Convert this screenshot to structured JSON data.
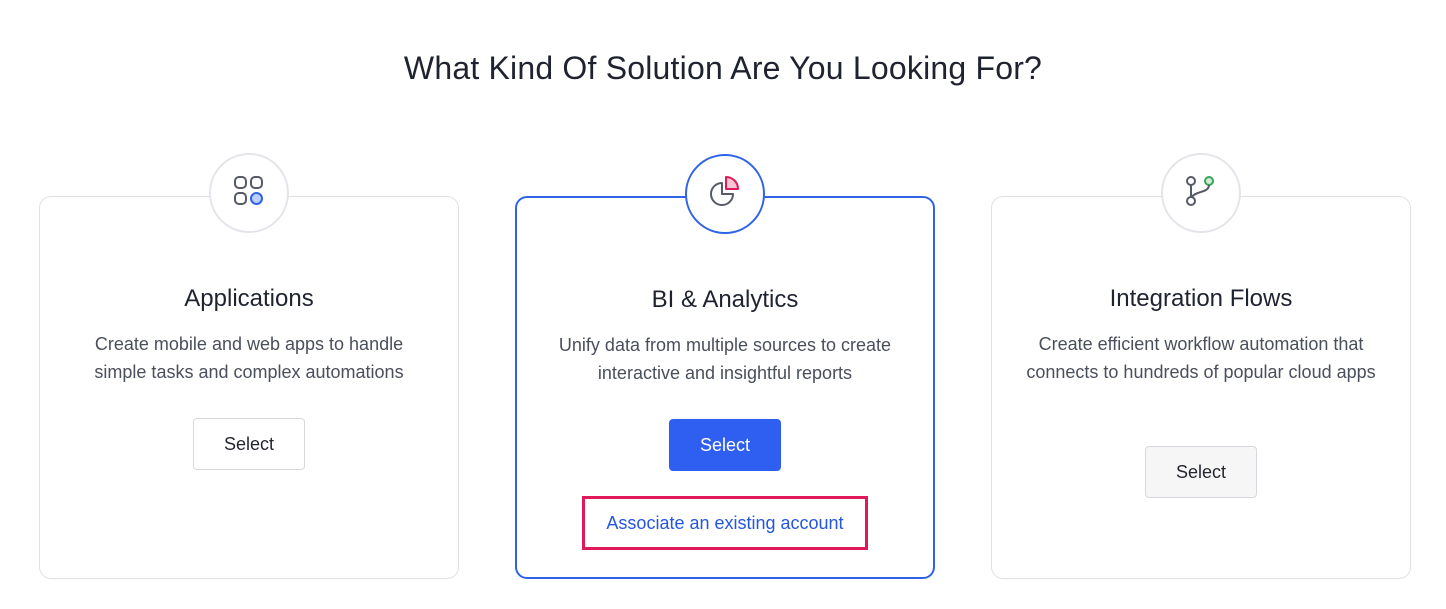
{
  "page": {
    "heading": "What Kind Of Solution Are You Looking For?"
  },
  "cards": [
    {
      "title": "Applications",
      "description": "Create mobile and web apps to handle simple tasks and complex automations",
      "select_label": "Select",
      "icon": "apps-grid-icon",
      "selected": false
    },
    {
      "title": "BI & Analytics",
      "description": "Unify data from multiple sources to create interactive and insightful reports",
      "select_label": "Select",
      "icon": "pie-chart-icon",
      "selected": true,
      "link_label": "Associate an existing account"
    },
    {
      "title": "Integration Flows",
      "description": "Create efficient workflow automation that connects to hundreds of popular cloud apps",
      "select_label": "Select",
      "icon": "git-branch-icon",
      "selected": false
    }
  ],
  "colors": {
    "accent": "#2f5ff0",
    "highlight_border": "#e0195a",
    "link": "#2456e0",
    "card_border": "#dfe1e6"
  }
}
